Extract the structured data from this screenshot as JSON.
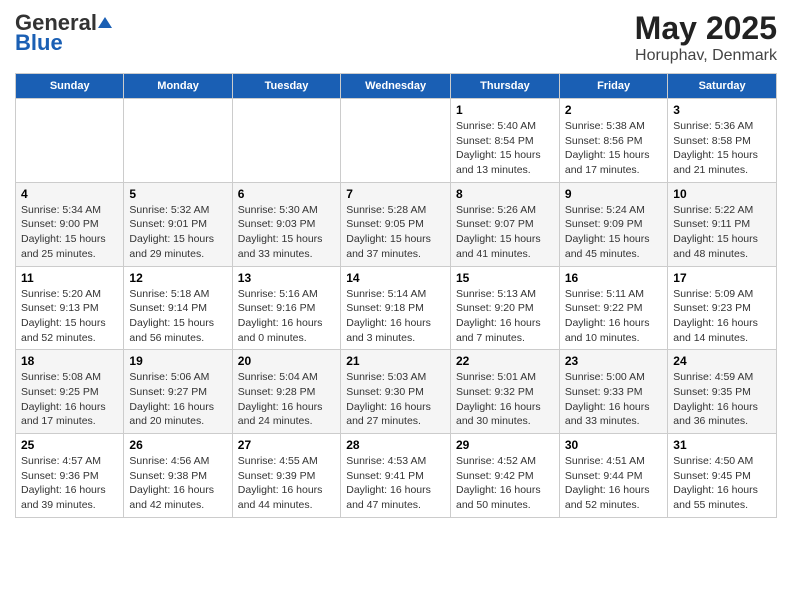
{
  "header": {
    "logo_general": "General",
    "logo_blue": "Blue",
    "title": "May 2025",
    "subtitle": "Horuphav, Denmark"
  },
  "weekdays": [
    "Sunday",
    "Monday",
    "Tuesday",
    "Wednesday",
    "Thursday",
    "Friday",
    "Saturday"
  ],
  "weeks": [
    [
      {
        "day": "",
        "info": ""
      },
      {
        "day": "",
        "info": ""
      },
      {
        "day": "",
        "info": ""
      },
      {
        "day": "",
        "info": ""
      },
      {
        "day": "1",
        "info": "Sunrise: 5:40 AM\nSunset: 8:54 PM\nDaylight: 15 hours\nand 13 minutes."
      },
      {
        "day": "2",
        "info": "Sunrise: 5:38 AM\nSunset: 8:56 PM\nDaylight: 15 hours\nand 17 minutes."
      },
      {
        "day": "3",
        "info": "Sunrise: 5:36 AM\nSunset: 8:58 PM\nDaylight: 15 hours\nand 21 minutes."
      }
    ],
    [
      {
        "day": "4",
        "info": "Sunrise: 5:34 AM\nSunset: 9:00 PM\nDaylight: 15 hours\nand 25 minutes."
      },
      {
        "day": "5",
        "info": "Sunrise: 5:32 AM\nSunset: 9:01 PM\nDaylight: 15 hours\nand 29 minutes."
      },
      {
        "day": "6",
        "info": "Sunrise: 5:30 AM\nSunset: 9:03 PM\nDaylight: 15 hours\nand 33 minutes."
      },
      {
        "day": "7",
        "info": "Sunrise: 5:28 AM\nSunset: 9:05 PM\nDaylight: 15 hours\nand 37 minutes."
      },
      {
        "day": "8",
        "info": "Sunrise: 5:26 AM\nSunset: 9:07 PM\nDaylight: 15 hours\nand 41 minutes."
      },
      {
        "day": "9",
        "info": "Sunrise: 5:24 AM\nSunset: 9:09 PM\nDaylight: 15 hours\nand 45 minutes."
      },
      {
        "day": "10",
        "info": "Sunrise: 5:22 AM\nSunset: 9:11 PM\nDaylight: 15 hours\nand 48 minutes."
      }
    ],
    [
      {
        "day": "11",
        "info": "Sunrise: 5:20 AM\nSunset: 9:13 PM\nDaylight: 15 hours\nand 52 minutes."
      },
      {
        "day": "12",
        "info": "Sunrise: 5:18 AM\nSunset: 9:14 PM\nDaylight: 15 hours\nand 56 minutes."
      },
      {
        "day": "13",
        "info": "Sunrise: 5:16 AM\nSunset: 9:16 PM\nDaylight: 16 hours\nand 0 minutes."
      },
      {
        "day": "14",
        "info": "Sunrise: 5:14 AM\nSunset: 9:18 PM\nDaylight: 16 hours\nand 3 minutes."
      },
      {
        "day": "15",
        "info": "Sunrise: 5:13 AM\nSunset: 9:20 PM\nDaylight: 16 hours\nand 7 minutes."
      },
      {
        "day": "16",
        "info": "Sunrise: 5:11 AM\nSunset: 9:22 PM\nDaylight: 16 hours\nand 10 minutes."
      },
      {
        "day": "17",
        "info": "Sunrise: 5:09 AM\nSunset: 9:23 PM\nDaylight: 16 hours\nand 14 minutes."
      }
    ],
    [
      {
        "day": "18",
        "info": "Sunrise: 5:08 AM\nSunset: 9:25 PM\nDaylight: 16 hours\nand 17 minutes."
      },
      {
        "day": "19",
        "info": "Sunrise: 5:06 AM\nSunset: 9:27 PM\nDaylight: 16 hours\nand 20 minutes."
      },
      {
        "day": "20",
        "info": "Sunrise: 5:04 AM\nSunset: 9:28 PM\nDaylight: 16 hours\nand 24 minutes."
      },
      {
        "day": "21",
        "info": "Sunrise: 5:03 AM\nSunset: 9:30 PM\nDaylight: 16 hours\nand 27 minutes."
      },
      {
        "day": "22",
        "info": "Sunrise: 5:01 AM\nSunset: 9:32 PM\nDaylight: 16 hours\nand 30 minutes."
      },
      {
        "day": "23",
        "info": "Sunrise: 5:00 AM\nSunset: 9:33 PM\nDaylight: 16 hours\nand 33 minutes."
      },
      {
        "day": "24",
        "info": "Sunrise: 4:59 AM\nSunset: 9:35 PM\nDaylight: 16 hours\nand 36 minutes."
      }
    ],
    [
      {
        "day": "25",
        "info": "Sunrise: 4:57 AM\nSunset: 9:36 PM\nDaylight: 16 hours\nand 39 minutes."
      },
      {
        "day": "26",
        "info": "Sunrise: 4:56 AM\nSunset: 9:38 PM\nDaylight: 16 hours\nand 42 minutes."
      },
      {
        "day": "27",
        "info": "Sunrise: 4:55 AM\nSunset: 9:39 PM\nDaylight: 16 hours\nand 44 minutes."
      },
      {
        "day": "28",
        "info": "Sunrise: 4:53 AM\nSunset: 9:41 PM\nDaylight: 16 hours\nand 47 minutes."
      },
      {
        "day": "29",
        "info": "Sunrise: 4:52 AM\nSunset: 9:42 PM\nDaylight: 16 hours\nand 50 minutes."
      },
      {
        "day": "30",
        "info": "Sunrise: 4:51 AM\nSunset: 9:44 PM\nDaylight: 16 hours\nand 52 minutes."
      },
      {
        "day": "31",
        "info": "Sunrise: 4:50 AM\nSunset: 9:45 PM\nDaylight: 16 hours\nand 55 minutes."
      }
    ]
  ]
}
